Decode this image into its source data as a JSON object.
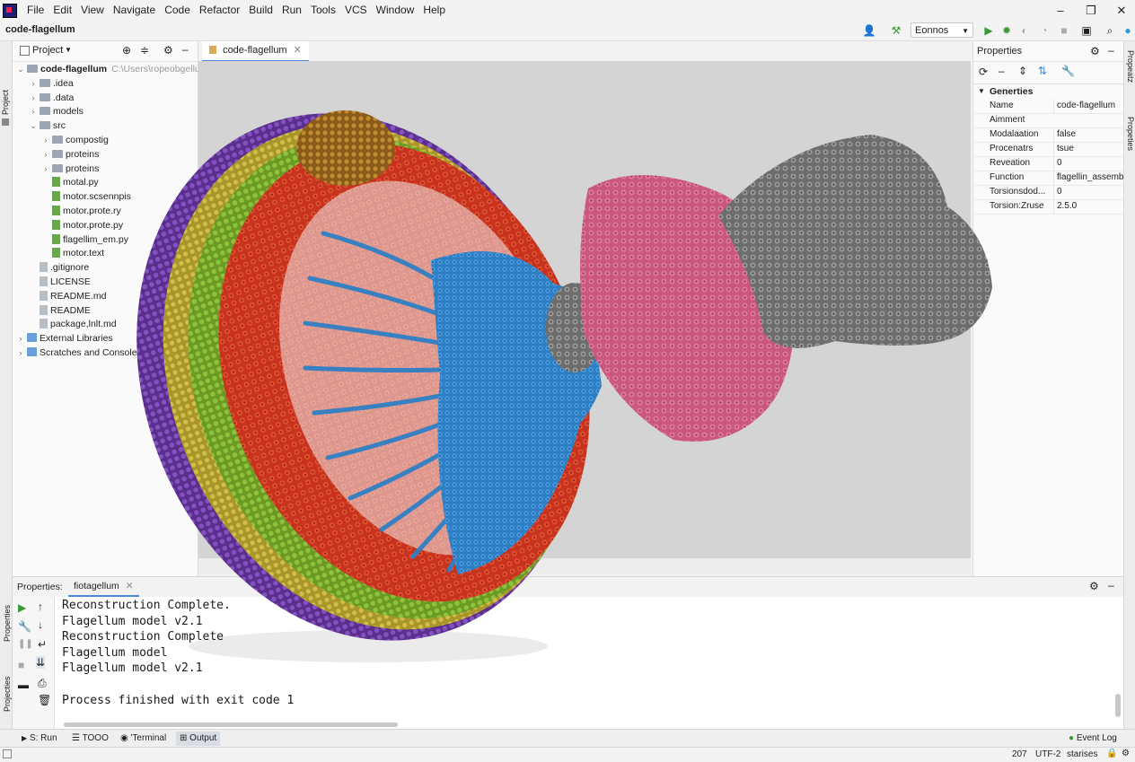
{
  "menubar": {
    "items": [
      "File",
      "Edit",
      "View",
      "Navigate",
      "Code",
      "Refactor",
      "Build",
      "Run",
      "Tools",
      "VCS",
      "Window",
      "Help"
    ]
  },
  "navbar": {
    "project_name": "code-flagellum",
    "run_config": "Eonnos"
  },
  "left_strip": {
    "label": "Project"
  },
  "project_panel": {
    "title": "Project",
    "tree": [
      {
        "label": "code-flagellum",
        "path": "C:\\Users\\ropeobgellum",
        "depth": 0,
        "kind": "folder",
        "expanded": true,
        "bold": true
      },
      {
        "label": ".idea",
        "depth": 1,
        "kind": "folder",
        "expanded": false
      },
      {
        "label": ".data",
        "depth": 1,
        "kind": "folder",
        "expanded": false
      },
      {
        "label": "models",
        "depth": 1,
        "kind": "folder",
        "expanded": false
      },
      {
        "label": "src",
        "depth": 1,
        "kind": "folder",
        "expanded": true
      },
      {
        "label": "compostig",
        "depth": 2,
        "kind": "folder",
        "expanded": false
      },
      {
        "label": "proteins",
        "depth": 2,
        "kind": "folder",
        "expanded": false
      },
      {
        "label": "proteins",
        "depth": 2,
        "kind": "folder",
        "expanded": false
      },
      {
        "label": "motal.py",
        "depth": 2,
        "kind": "py"
      },
      {
        "label": "motor.scsennpis",
        "depth": 2,
        "kind": "py"
      },
      {
        "label": "motor.prote.ry",
        "depth": 2,
        "kind": "py"
      },
      {
        "label": "motor.prote.py",
        "depth": 2,
        "kind": "py"
      },
      {
        "label": "flagellim_em.py",
        "depth": 2,
        "kind": "py"
      },
      {
        "label": "motor.text",
        "depth": 2,
        "kind": "py"
      },
      {
        "label": ".gitignore",
        "depth": 1,
        "kind": "txt"
      },
      {
        "label": "LICENSE",
        "depth": 1,
        "kind": "txt"
      },
      {
        "label": "README.md",
        "depth": 1,
        "kind": "txt"
      },
      {
        "label": "README",
        "depth": 1,
        "kind": "txt"
      },
      {
        "label": "package,lnlt.md",
        "depth": 1,
        "kind": "txt"
      },
      {
        "label": "External Libraries",
        "depth": 0,
        "kind": "lib",
        "expanded": false
      },
      {
        "label": "Scratches and Consoles",
        "depth": 0,
        "kind": "lib",
        "expanded": false
      }
    ]
  },
  "editor": {
    "tab_label": "code-flagellum"
  },
  "properties": {
    "title": "Properties",
    "section": "Generties",
    "rows": [
      {
        "key": "Name",
        "value": "code-flagellum"
      },
      {
        "key": "Aimment",
        "value": ""
      },
      {
        "key": "Modalaation",
        "value": "false"
      },
      {
        "key": "Procenatrs",
        "value": "tsue"
      },
      {
        "key": "Reveation",
        "value": "0"
      },
      {
        "key": "Function",
        "value": "flagellin_assembly"
      },
      {
        "key": "Torsionsdod...",
        "value": "0"
      },
      {
        "key": "Torsion:Zruse",
        "value": "2.5.0"
      }
    ],
    "side_labels": [
      "Propeatz",
      "Propeties"
    ]
  },
  "bottom_panel": {
    "title": "Properties:",
    "tab": "fiotagellum",
    "side_labels": [
      "Properties",
      "Projecties"
    ],
    "console_lines": [
      "Reconstruction Complete.",
      "Flagellum model v2.1",
      "Reconstruction Complete",
      "Flagellum model",
      "Flagellum model v2.1",
      "",
      "Process finished with exit code 1"
    ]
  },
  "tool_tabs": [
    {
      "label": "S: Run",
      "icon": "play-icon"
    },
    {
      "label": "TOOO",
      "icon": "list-icon"
    },
    {
      "label": "'Terminal",
      "icon": "terminal-icon"
    },
    {
      "label": "Output",
      "icon": "output-icon",
      "active": true
    }
  ],
  "event_log": "Event Log",
  "status_bar": {
    "position": "207",
    "encoding": "UTF-2",
    "extra": "starises"
  },
  "colors": {
    "accent": "#4a88d8",
    "run_green": "#3a9a3a",
    "blue_protein": "#2f7fc4",
    "red_protein": "#c7331f",
    "pink_protein": "#c9577f",
    "gray_protein": "#7b7b7b",
    "green_protein": "#7aab2e",
    "purple_protein": "#6a3aa0",
    "gold_protein": "#b8a52a",
    "brown_protein": "#a06a1e"
  }
}
